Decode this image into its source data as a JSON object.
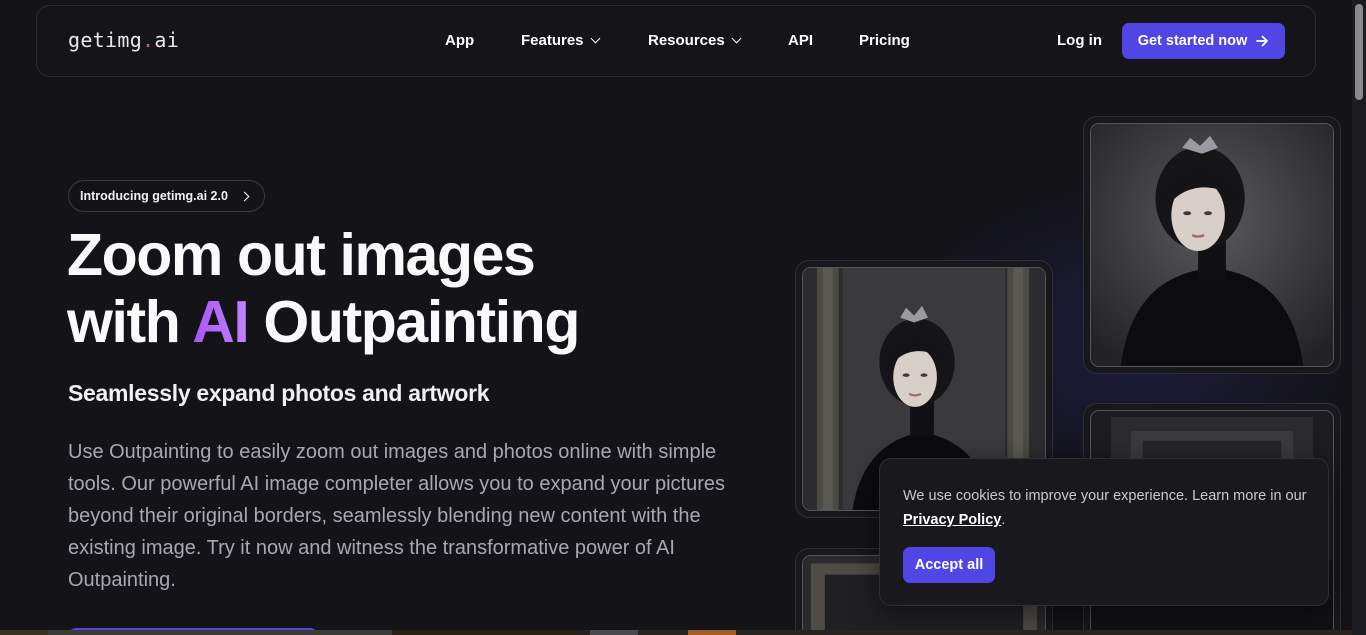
{
  "nav": {
    "logo_prefix": "getimg",
    "logo_dot": ".",
    "logo_suffix": "ai",
    "links": [
      {
        "label": "App",
        "dropdown": false
      },
      {
        "label": "Features",
        "dropdown": true
      },
      {
        "label": "Resources",
        "dropdown": true
      },
      {
        "label": "API",
        "dropdown": false
      },
      {
        "label": "Pricing",
        "dropdown": false
      }
    ],
    "login_label": "Log in",
    "cta_label": "Get started now",
    "cta_icon": "arrow-right-icon"
  },
  "hero": {
    "badge_label": "Introducing getimg.ai 2.0",
    "title_line1": "Zoom out images",
    "title_line2_pre": "with ",
    "title_line2_accent": "AI",
    "title_line2_post": " Outpainting",
    "subtitle": "Seamlessly expand photos and artwork",
    "description": "Use Outpainting to easily zoom out images and photos online with simple tools. Our powerful AI image completer allows you to expand your pictures beyond their original borders, seamlessly blending new content with the existing image. Try it now and witness the transformative power of AI Outpainting."
  },
  "cookie": {
    "text_pre": "We use cookies to improve your experience. Learn more in our ",
    "link_label": "Privacy Policy",
    "text_post": ".",
    "accept_label": "Accept all"
  },
  "colors": {
    "background": "#131318",
    "accent": "#4f46e5",
    "ai_gradient_start": "#a855f7",
    "logo_dot": "#e84a5f"
  }
}
